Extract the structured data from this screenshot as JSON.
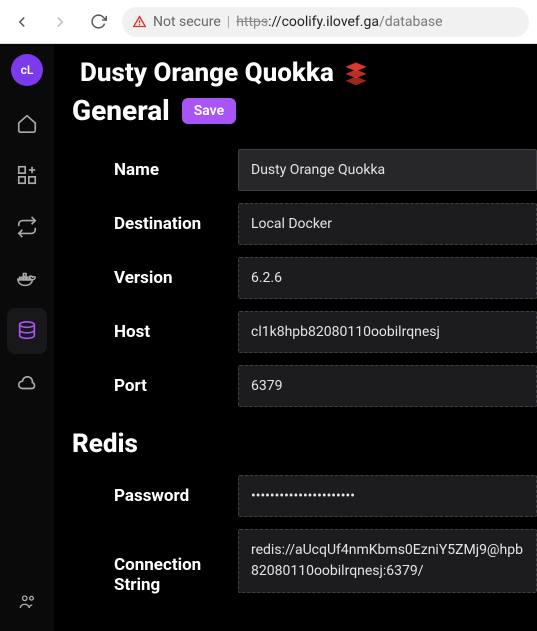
{
  "browser": {
    "not_secure_label": "Not secure",
    "url_https": "https",
    "url_host": "://coolify.ilovef.ga",
    "url_path": "/database"
  },
  "avatar_initials": "cL",
  "page_title": "Dusty Orange Quokka",
  "general_heading": "General",
  "save_label": "Save",
  "fields": {
    "name": {
      "label": "Name",
      "value": "Dusty Orange Quokka"
    },
    "destination": {
      "label": "Destination",
      "value": "Local Docker"
    },
    "version": {
      "label": "Version",
      "value": "6.2.6"
    },
    "host": {
      "label": "Host",
      "value": "cl1k8hpb82080110oobilrqnesj"
    },
    "port": {
      "label": "Port",
      "value": "6379"
    }
  },
  "redis_heading": "Redis",
  "redis": {
    "password": {
      "label": "Password",
      "value": "••••••••••••••••••••••"
    },
    "conn": {
      "label": "Connection String",
      "value": "redis://aUcqUf4nmKbms0EzniY5ZMj9@hpb82080110oobilrqnesj:6379/"
    }
  }
}
